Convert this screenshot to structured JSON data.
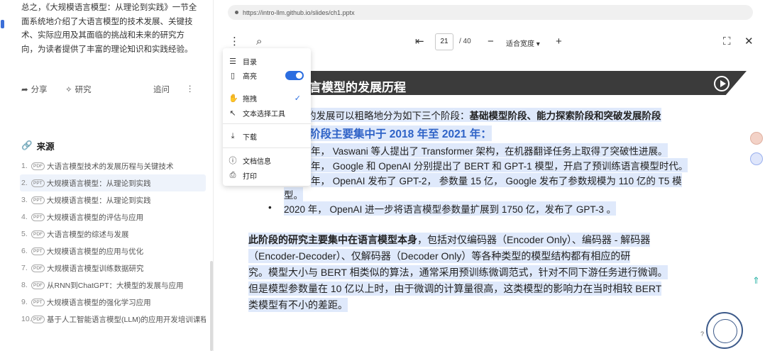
{
  "left": {
    "summary": "总之，《大规模语言模型：从理论到实践》一节全面系统地介绍了大语言模型的技术发展、关键技术、实际应用及其面临的挑战和未来的研究方向，为读者提供了丰富的理论知识和实践经验。",
    "actions": {
      "share": "分享",
      "research": "研究",
      "ask": "追问"
    },
    "sources_title": "来源",
    "sources": [
      {
        "num": "1.",
        "badge": "PDF",
        "text": "大语言模型技术的发展历程与关键技术"
      },
      {
        "num": "2.",
        "badge": "PPT",
        "text": "大规模语言模型：从理论到实践"
      },
      {
        "num": "3.",
        "badge": "PPT",
        "text": "大规模语言模型：从理论到实践"
      },
      {
        "num": "4.",
        "badge": "PPT",
        "text": "大规模语言模型的评估与应用"
      },
      {
        "num": "5.",
        "badge": "PDF",
        "text": "大语言模型的综述与发展"
      },
      {
        "num": "6.",
        "badge": "PPT",
        "text": "大规模语言模型的应用与优化"
      },
      {
        "num": "7.",
        "badge": "PDF",
        "text": "大规模语言模型训练数据研究"
      },
      {
        "num": "8.",
        "badge": "PDF",
        "text": "从RNN到ChatGPT：大模型的发展与应用"
      },
      {
        "num": "9.",
        "badge": "PPT",
        "text": "大规模语言模型的强化学习应用"
      },
      {
        "num": "10.",
        "badge": "PDF",
        "text": "基于人工智能语言模型(LLM)的应用开发培训课程"
      }
    ]
  },
  "viewer": {
    "url": "https://intro-llm.github.io/slides/ch1.pptx",
    "page_current": "21",
    "page_total": "/ 40",
    "zoom_label": "适合宽度",
    "menu": {
      "outline": "目录",
      "highlight": "高亮",
      "hand": "拖拽",
      "text_select": "文本选择工具",
      "download": "下载",
      "doc_info": "文档信息",
      "print": "打印"
    },
    "slide": {
      "banner_title": "言模型的发展历程",
      "line1_a": "的发展可以粗略地分为如下三个阶段：",
      "line1_b": "基础模型阶段、能力探索阶段和突破发展阶段",
      "heading": "阶段主要集中于 2018 年至 2021 年：",
      "b1": "年，  Vaswani  等人提出了 Transformer 架构，在机器翻译任务上取得了突破性进展。",
      "b2": "年，  Google  和 OpenAI  分别提出了 BERT  和  GPT-1 模型，开启了预训练语言模型时代。",
      "b3": "年，  OpenAI  发布了 GPT-2，  参数量 15  亿，  Google  发布了参数规模为 110  亿的 T5 模",
      "b3_cont": "型。",
      "b4": "2020  年，  OpenAI  进一步将语言模型参数量扩展到 1750  亿，发布了 GPT-3 。",
      "p1_bold": "此阶段的研究主要集中在语言模型本身",
      "p1_rest": "，包括对仅编码器（Encoder Only）、编码器 - 解码器",
      "p2": "（Encoder-Decoder）、仅解码器（Decoder Only）等各种类型的模型结构都有相应的研",
      "p3": "究。模型大小与 BERT  相类似的算法，通常采用预训练微调范式，针对不同下游任务进行微调。",
      "p4": "但是模型参数量在 10  亿以上时，由于微调的计算量很高，这类模型的影响力在当时相较 BERT",
      "p5": "类模型有不小的差距。"
    }
  },
  "colors": {
    "accent": "#2b6de0",
    "banner": "#3b3b3b",
    "highlight": "#dfe9fb",
    "heading_blue": "#2f63c7"
  }
}
